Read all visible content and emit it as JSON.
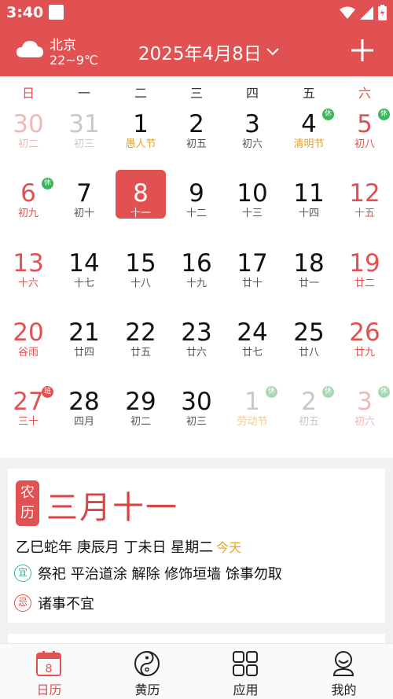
{
  "status_bar": {
    "time": "3:40"
  },
  "header": {
    "city": "北京",
    "temperature": "22~9℃",
    "date_title": "2025年4月8日",
    "weather_icon": "cloud-icon",
    "accent_color": "#e15151"
  },
  "weekdays": [
    "日",
    "一",
    "二",
    "三",
    "四",
    "五",
    "六"
  ],
  "calendar": {
    "rows": [
      [
        {
          "num": "30",
          "lunar": "初二",
          "other": true
        },
        {
          "num": "31",
          "lunar": "初三",
          "other": true
        },
        {
          "num": "1",
          "lunar": "愚人节",
          "fest": true
        },
        {
          "num": "2",
          "lunar": "初五"
        },
        {
          "num": "3",
          "lunar": "初六"
        },
        {
          "num": "4",
          "lunar": "清明节",
          "fest": true,
          "badge": "休"
        },
        {
          "num": "5",
          "lunar": "初八",
          "badge": "休"
        }
      ],
      [
        {
          "num": "6",
          "lunar": "初九",
          "badge": "休"
        },
        {
          "num": "7",
          "lunar": "初十"
        },
        {
          "num": "8",
          "lunar": "十一",
          "selected": true
        },
        {
          "num": "9",
          "lunar": "十二"
        },
        {
          "num": "10",
          "lunar": "十三"
        },
        {
          "num": "11",
          "lunar": "十四"
        },
        {
          "num": "12",
          "lunar": "十五"
        }
      ],
      [
        {
          "num": "13",
          "lunar": "十六"
        },
        {
          "num": "14",
          "lunar": "十七"
        },
        {
          "num": "15",
          "lunar": "十八"
        },
        {
          "num": "16",
          "lunar": "十九"
        },
        {
          "num": "17",
          "lunar": "廿十"
        },
        {
          "num": "18",
          "lunar": "廿一"
        },
        {
          "num": "19",
          "lunar": "廿二"
        }
      ],
      [
        {
          "num": "20",
          "lunar": "谷雨",
          "term": true
        },
        {
          "num": "21",
          "lunar": "廿四"
        },
        {
          "num": "22",
          "lunar": "廿五"
        },
        {
          "num": "23",
          "lunar": "廿六"
        },
        {
          "num": "24",
          "lunar": "廿七"
        },
        {
          "num": "25",
          "lunar": "廿八"
        },
        {
          "num": "26",
          "lunar": "廿九"
        }
      ],
      [
        {
          "num": "27",
          "lunar": "三十",
          "badge": "班"
        },
        {
          "num": "28",
          "lunar": "四月"
        },
        {
          "num": "29",
          "lunar": "初二"
        },
        {
          "num": "30",
          "lunar": "初三"
        },
        {
          "num": "1",
          "lunar": "劳动节",
          "other": true,
          "fest": true,
          "badge": "休"
        },
        {
          "num": "2",
          "lunar": "初五",
          "other": true,
          "badge": "休"
        },
        {
          "num": "3",
          "lunar": "初六",
          "other": true,
          "badge": "休"
        }
      ]
    ]
  },
  "almanac": {
    "tag": "农历",
    "lunar_date": "三月十一",
    "ganzhi": "乙巳蛇年 庚辰月 丁未日 星期二",
    "today_label": "今天",
    "yi_icon": "宜",
    "yi_text": "祭祀 平治道涂 解除 修饰垣墙 馀事勿取",
    "ji_icon": "忌",
    "ji_text": "诸事不宜"
  },
  "nav": {
    "calendar_label": "日历",
    "calendar_icon_day": "8",
    "almanac_label": "黄历",
    "apps_label": "应用",
    "me_label": "我的"
  }
}
